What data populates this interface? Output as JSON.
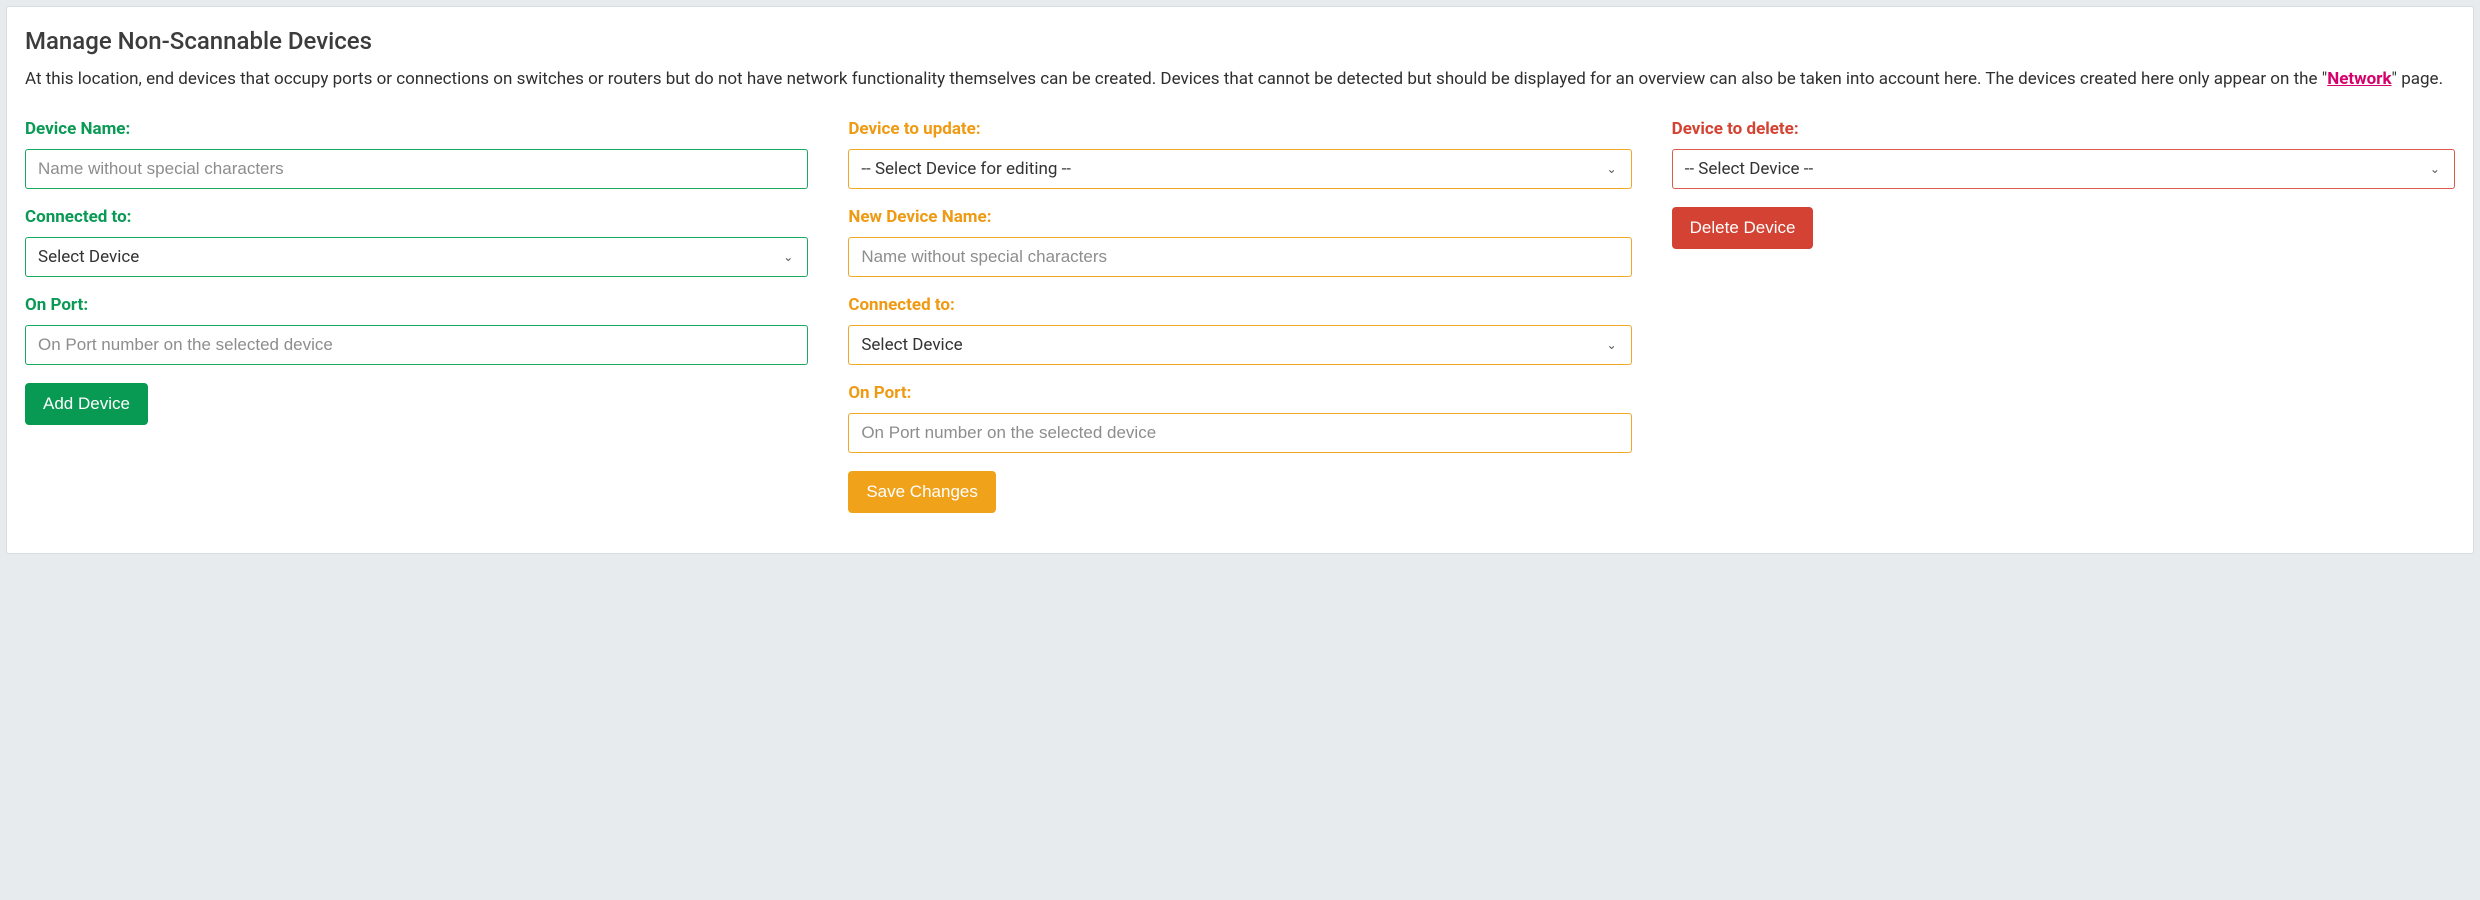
{
  "title": "Manage Non-Scannable Devices",
  "description": {
    "part1": "At this location, end devices that occupy ports or connections on switches or routers but do not have network functionality themselves can be created. Devices that cannot be detected but should be displayed for an overview can also be taken into account here. The devices created here only appear on the \"",
    "link_text": "Network",
    "part2": "\" page."
  },
  "create": {
    "device_name_label": "Device Name:",
    "device_name_placeholder": "Name without special characters",
    "connected_to_label": "Connected to:",
    "connected_to_value": "Select Device",
    "on_port_label": "On Port:",
    "on_port_placeholder": "On Port number on the selected device",
    "button": "Add Device"
  },
  "update": {
    "device_to_update_label": "Device to update:",
    "device_to_update_value": "-- Select Device for editing --",
    "new_name_label": "New Device Name:",
    "new_name_placeholder": "Name without special characters",
    "connected_to_label": "Connected to:",
    "connected_to_value": "Select Device",
    "on_port_label": "On Port:",
    "on_port_placeholder": "On Port number on the selected device",
    "button": "Save Changes"
  },
  "delete": {
    "device_to_delete_label": "Device to delete:",
    "device_to_delete_value": "-- Select Device --",
    "button": "Delete Device"
  }
}
